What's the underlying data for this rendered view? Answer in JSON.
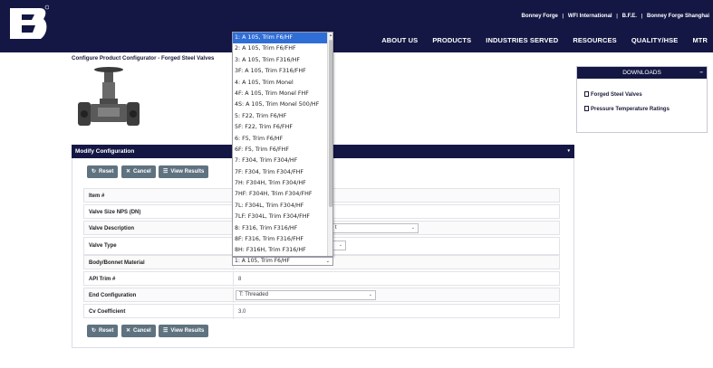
{
  "header": {
    "logo_text": "B",
    "top_links": [
      "Bonney Forge",
      "WFI International",
      "B.F.E.",
      "Bonney Forge Shanghai"
    ],
    "nav": [
      "ABOUT US",
      "PRODUCTS",
      "INDUSTRIES SERVED",
      "RESOURCES",
      "QUALITY/HSE",
      "MTR"
    ]
  },
  "breadcrumb": "Configure Product Configurator - Forged Steel Valves",
  "downloads": {
    "title": "DOWNLOADS",
    "collapse": "−",
    "items": [
      "Forged Steel Valves",
      "Pressure Temperature Ratings"
    ]
  },
  "modify": {
    "title": "Modify Configuration",
    "caret": "▾",
    "buttons": {
      "reset": "Reset",
      "cancel": "Cancel",
      "view": "View Results"
    },
    "rows": [
      {
        "label": "Item #",
        "value": ""
      },
      {
        "label": "Valve Size NPS (DN)",
        "value": ""
      },
      {
        "label": "Valve Description",
        "value": "t"
      },
      {
        "label": "Valve Type",
        "value": ""
      },
      {
        "label": "Body/Bonnet Material",
        "value": "1: A 105, Trim F6/HF"
      },
      {
        "label": "API Trim #",
        "value": "8"
      },
      {
        "label": "End Configuration",
        "value": "T: Threaded"
      },
      {
        "label": "Cv Coefficient",
        "value": "3.0"
      }
    ]
  },
  "dropdown": {
    "options": [
      "1: A 105, Trim F6/HF",
      "2: A 105, Trim F6/FHF",
      "3: A 105, Trim F316/HF",
      "3F: A 105, Trim F316/FHF",
      "4: A 105, Trim Monel",
      "4F: A 105, Trim Monel FHF",
      "4S: A 105, Trim Monel 500/HF",
      "5: F22, Trim F6/HF",
      "5F: F22, Trim F6/FHF",
      "6: F5, Trim F6/HF",
      "6F: F5, Trim F6/FHF",
      "7: F304, Trim F304/HF",
      "7F: F304, Trim F304/FHF",
      "7H: F304H, Trim F304/HF",
      "7HF: F304H, Trim F304/FHF",
      "7L: F304L, Trim F304/HF",
      "7LF: F304L, Trim F304/FHF",
      "8: F316, Trim F316/HF",
      "8F: F316, Trim F316/FHF",
      "8H: F316H, Trim F316/HF"
    ],
    "selected_index": 0,
    "closed_value": "1: A 105, Trim F6/HF"
  },
  "colors": {
    "navy": "#141744",
    "button": "#5f7280",
    "selected": "#2f6ed6"
  }
}
